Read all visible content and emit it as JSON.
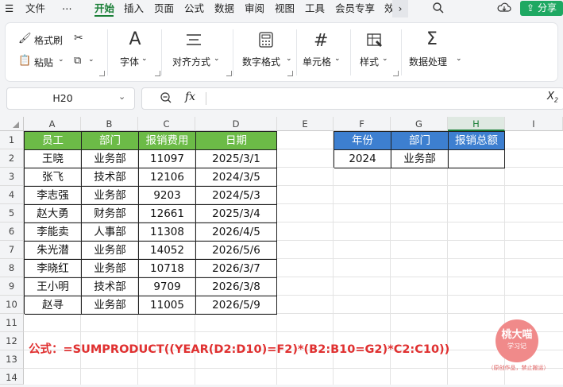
{
  "menu": {
    "file_label": "文件",
    "more": "⋯",
    "tabs": [
      "开始",
      "插入",
      "页面",
      "公式",
      "数据",
      "审阅",
      "视图",
      "工具",
      "会员专享",
      "效"
    ],
    "active_tab": "开始",
    "share_label": "分享"
  },
  "ribbon": {
    "format_painter": "格式刷",
    "paste": "粘贴",
    "font": "字体",
    "align": "对齐方式",
    "number_format": "数字格式",
    "cell": "单元格",
    "style": "样式",
    "data_process": "数据处理"
  },
  "formula_bar": {
    "name_box": "H20",
    "fx": "fx",
    "formula": ""
  },
  "columns": [
    "A",
    "B",
    "C",
    "D",
    "E",
    "F",
    "G",
    "H",
    "I"
  ],
  "selected_column": "H",
  "rows": [
    "1",
    "2",
    "3",
    "4",
    "5",
    "6",
    "7",
    "8",
    "9",
    "10",
    "11",
    "12",
    "13",
    "14"
  ],
  "table": {
    "headers": [
      "员工",
      "部门",
      "报销费用",
      "日期"
    ],
    "rows": [
      [
        "王晓",
        "业务部",
        "11097",
        "2025/3/1"
      ],
      [
        "张飞",
        "技术部",
        "12106",
        "2024/3/5"
      ],
      [
        "李志强",
        "业务部",
        "9203",
        "2024/5/3"
      ],
      [
        "赵大勇",
        "财务部",
        "12661",
        "2025/3/4"
      ],
      [
        "李能卖",
        "人事部",
        "11308",
        "2026/4/5"
      ],
      [
        "朱光潜",
        "业务部",
        "14052",
        "2026/5/6"
      ],
      [
        "李晓红",
        "业务部",
        "10718",
        "2026/3/7"
      ],
      [
        "王小明",
        "技术部",
        "9709",
        "2026/3/8"
      ],
      [
        "赵寻",
        "业务部",
        "11005",
        "2026/5/9"
      ]
    ]
  },
  "criteria": {
    "headers": [
      "年份",
      "部门",
      "报销总额"
    ],
    "values": [
      "2024",
      "业务部",
      ""
    ]
  },
  "note": "公式：=SUMPRODUCT((YEAR(D2:D10)=F2)*(B2:B10=G2)*C2:C10))",
  "logo": {
    "name": "桃大喵",
    "sub": "学习记",
    "tagline": "（原创作品，禁止搬运）"
  },
  "colors": {
    "accent": "#1a7f37",
    "header_green": "#6cbb47",
    "header_blue": "#3d7fd0",
    "note_red": "#e03030"
  }
}
